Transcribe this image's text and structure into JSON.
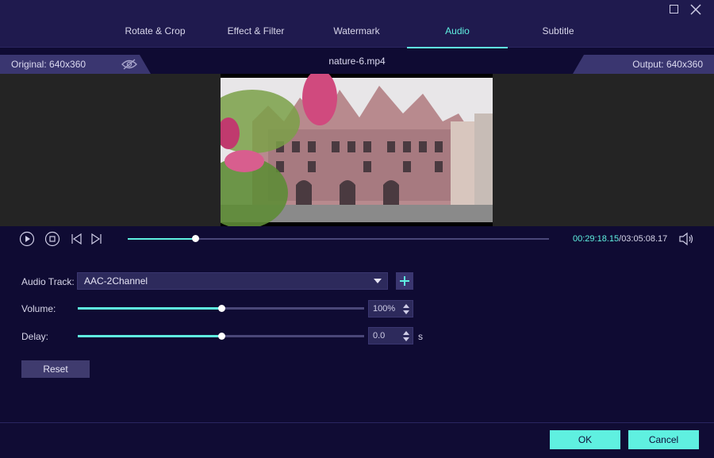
{
  "tabs": [
    {
      "label": "Rotate & Crop",
      "active": false
    },
    {
      "label": "Effect & Filter",
      "active": false
    },
    {
      "label": "Watermark",
      "active": false
    },
    {
      "label": "Audio",
      "active": true
    },
    {
      "label": "Subtitle",
      "active": false
    }
  ],
  "info": {
    "original": "Original: 640x360",
    "filename": "nature-6.mp4",
    "output": "Output: 640x360"
  },
  "playback": {
    "current_time": "00:29:18.15",
    "separator": "/",
    "total_time": "03:05:08.17",
    "progress_fraction": 0.16
  },
  "audio": {
    "track_label": "Audio Track:",
    "track_value": "AAC-2Channel",
    "volume_label": "Volume:",
    "volume_value": "100%",
    "volume_fraction": 0.5,
    "delay_label": "Delay:",
    "delay_value": "0.0",
    "delay_fraction": 0.5,
    "delay_unit": "s",
    "reset_label": "Reset"
  },
  "footer": {
    "ok_label": "OK",
    "cancel_label": "Cancel"
  },
  "colors": {
    "accent": "#5ff0e0",
    "background": "#0f0b33",
    "panel": "#1f1a4e"
  }
}
